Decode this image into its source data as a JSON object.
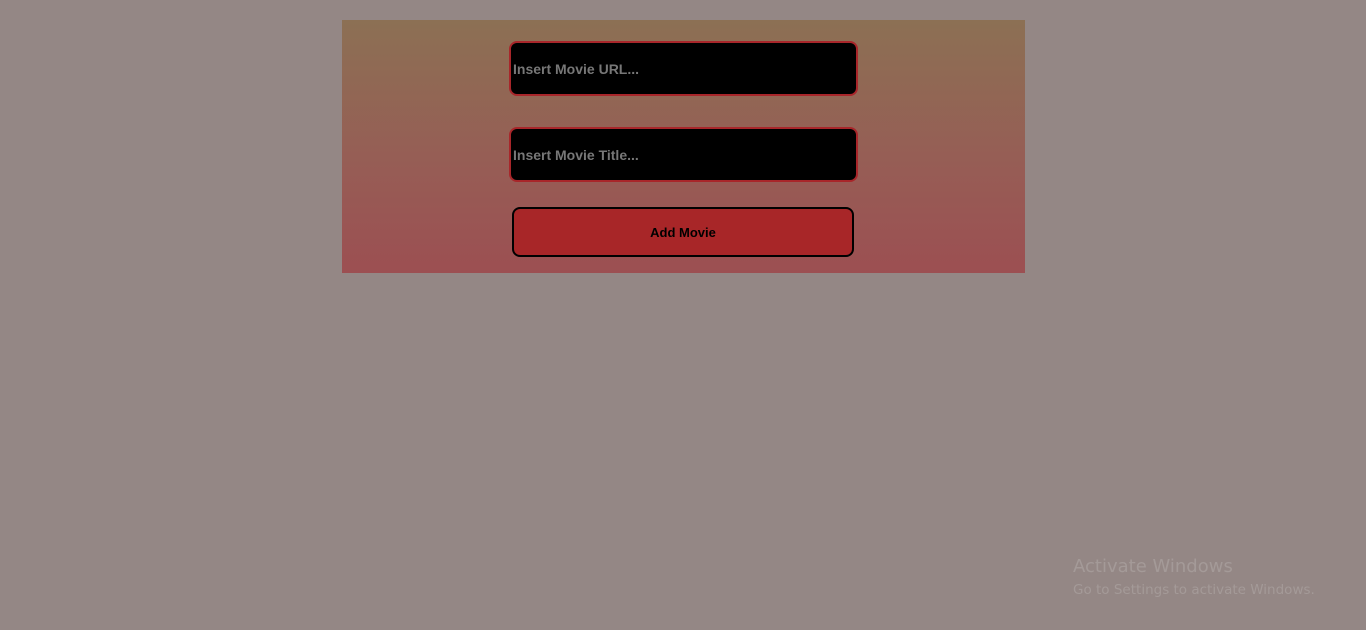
{
  "form": {
    "url_input": {
      "value": "",
      "placeholder": "Insert Movie URL..."
    },
    "title_input": {
      "value": "",
      "placeholder": "Insert Movie Title..."
    },
    "submit_label": "Add Movie"
  },
  "windows_watermark": {
    "title": "Activate Windows",
    "subtitle": "Go to Settings to activate Windows."
  },
  "colors": {
    "page_background": "#948785",
    "panel_gradient_top": "#8c7054",
    "panel_gradient_bottom": "#9c4f52",
    "input_background": "#000000",
    "input_border": "#a8262a",
    "button_background": "#a82628",
    "placeholder_text": "#777777"
  }
}
